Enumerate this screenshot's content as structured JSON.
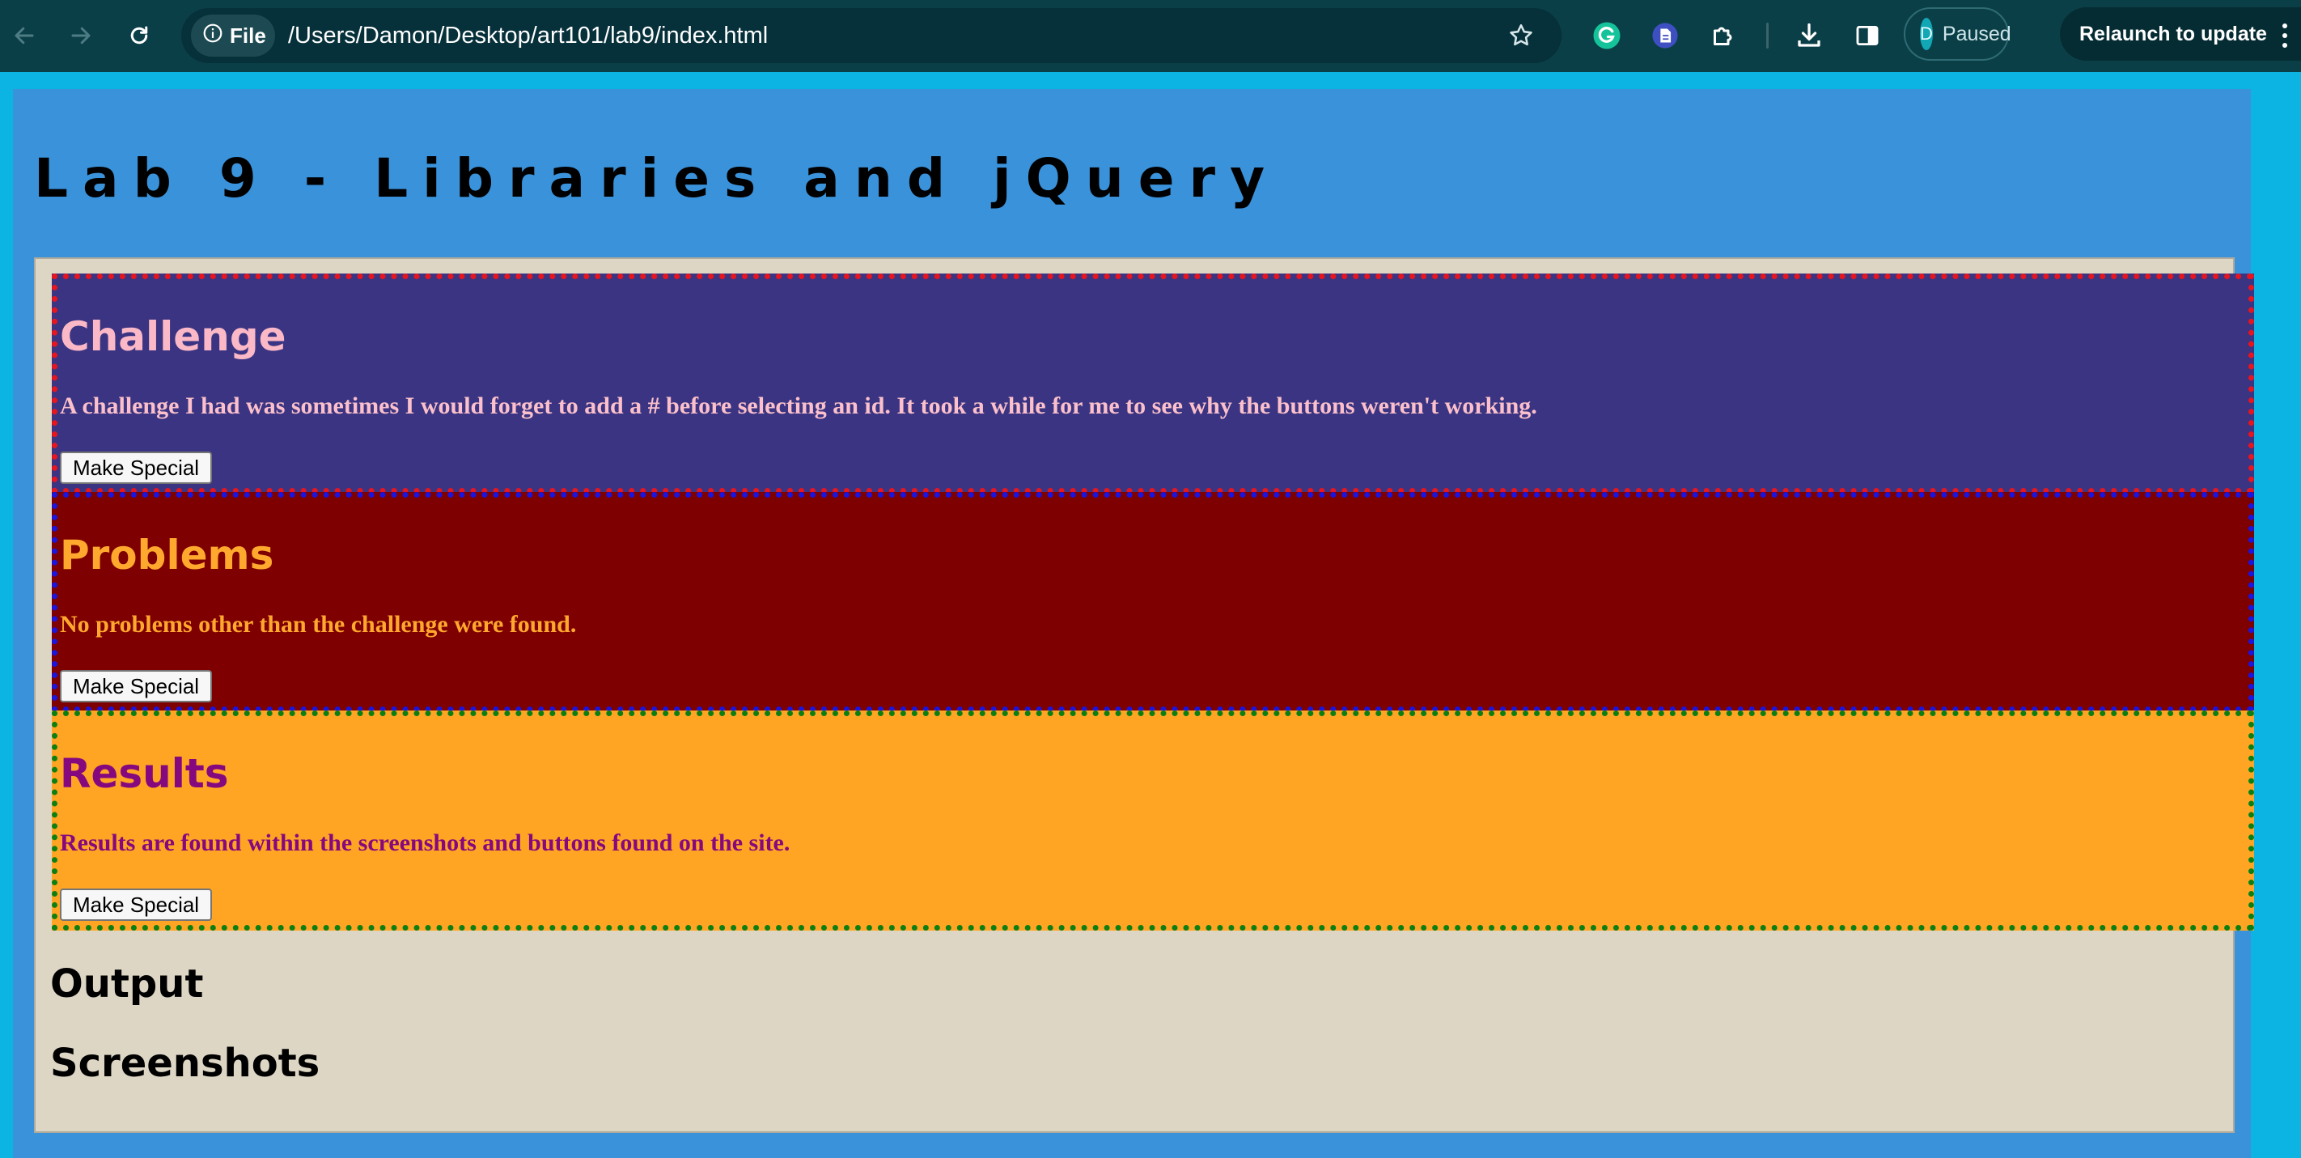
{
  "browser": {
    "url_chip": "File",
    "url": "/Users/Damon/Desktop/art101/lab9/index.html",
    "profile_initial": "D",
    "profile_status": "Paused",
    "relaunch_label": "Relaunch to update",
    "icons": [
      "back-arrow-icon",
      "forward-arrow-icon",
      "reload-icon",
      "info-icon",
      "star-icon",
      "grammarly-icon",
      "doc-extension-icon",
      "puzzle-extensions-icon",
      "download-icon",
      "side-panel-icon",
      "kebab-menu-icon"
    ],
    "colors": {
      "toolbar": "#0b3f48",
      "omnibox": "#06303a",
      "frame": "#0bb4e3"
    }
  },
  "page": {
    "title": "Lab 9 - Libraries and jQuery",
    "colors": {
      "background": "#3a92da",
      "content": "#ddd6c5"
    },
    "sections": [
      {
        "heading": "Challenge",
        "text": "A challenge I had was sometimes I would forget to add a # before selecting an id. It took a while for me to see why the buttons weren't working.",
        "button": "Make Special",
        "colors": {
          "background": "#3a3482",
          "text": "#fbc0cb",
          "border": "#e8151f"
        }
      },
      {
        "heading": "Problems",
        "text": "No problems other than the challenge were found.",
        "button": "Make Special",
        "colors": {
          "background": "#7f0000",
          "text": "#ffa82e",
          "border": "#1a15e0"
        }
      },
      {
        "heading": "Results",
        "text": "Results are found within the screenshots and buttons found on the site.",
        "button": "Make Special",
        "colors": {
          "background": "#ffa523",
          "text": "#86087f",
          "border": "#0d7f12"
        }
      }
    ],
    "output_heading": "Output",
    "screenshots_heading": "Screenshots"
  }
}
